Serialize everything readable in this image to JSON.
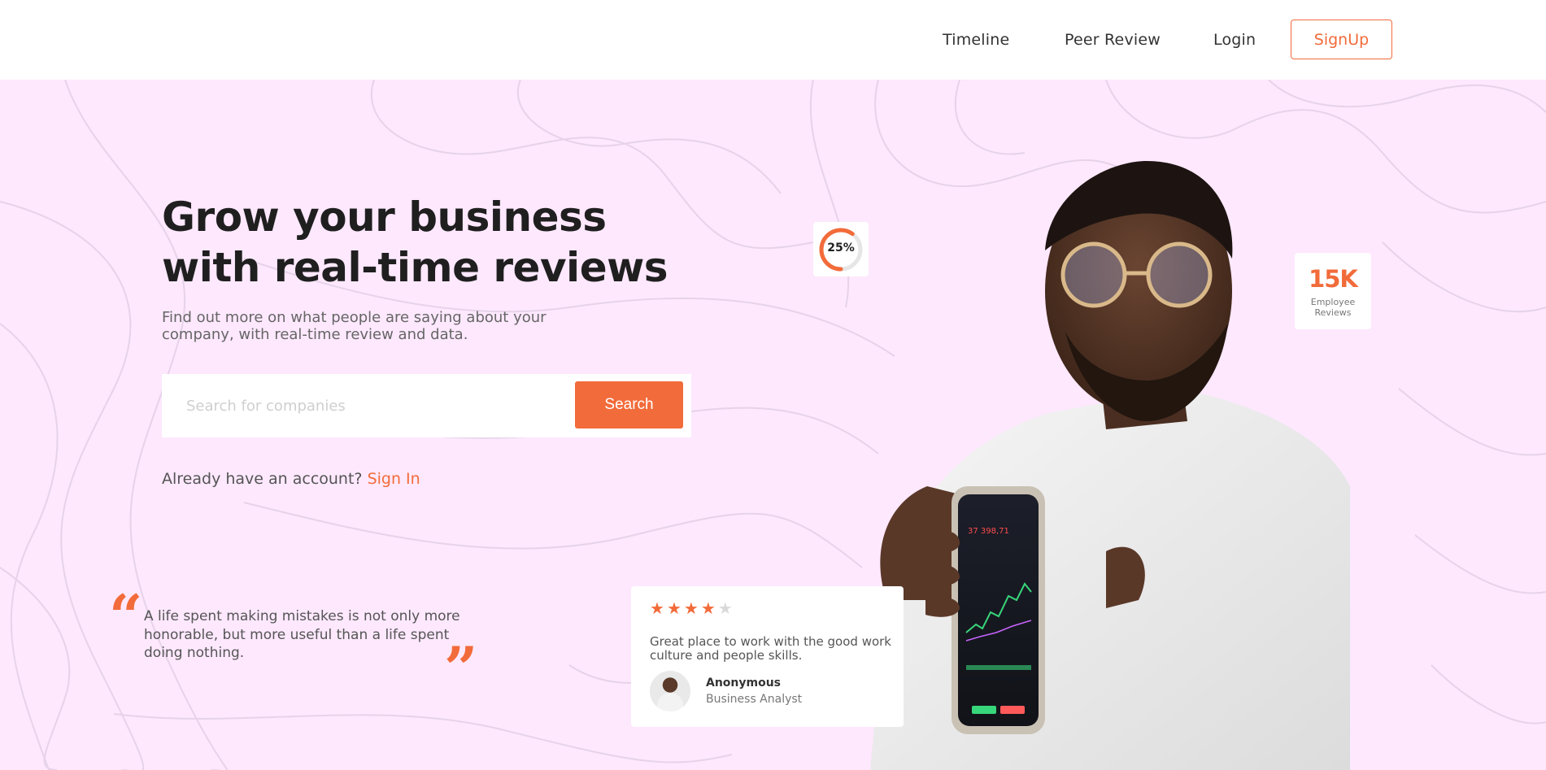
{
  "nav": {
    "timeline": "Timeline",
    "peer_review": "Peer Review",
    "login": "Login",
    "signup": "SignUp"
  },
  "hero": {
    "headline": "Grow your business with real-time reviews",
    "subtext": "Find out more on what people are saying about your company, with real-time review and data.",
    "search_placeholder": "Search for companies",
    "search_button": "Search",
    "account_prompt": "Already have an account?",
    "signin_link": "Sign In"
  },
  "quote": {
    "text": "A life spent making mistakes is not only more honorable, but more useful than a life spent doing nothing."
  },
  "review": {
    "rating": 4,
    "max_rating": 5,
    "text": "Great place to work with the good work culture and people skills.",
    "name": "Anonymous",
    "role": "Business Analyst"
  },
  "progress_badge": {
    "label": "25%",
    "value": 0.25
  },
  "stat_badge": {
    "value": "15K",
    "label": "Employee Reviews"
  },
  "colors": {
    "accent": "#f26b3a",
    "hero_bg": "#fde8fd",
    "heading": "#1f1f1f",
    "body_text": "#666666"
  },
  "icons": {
    "quote_open": "quote-open-icon",
    "quote_close": "quote-close-icon",
    "star": "star-icon"
  }
}
